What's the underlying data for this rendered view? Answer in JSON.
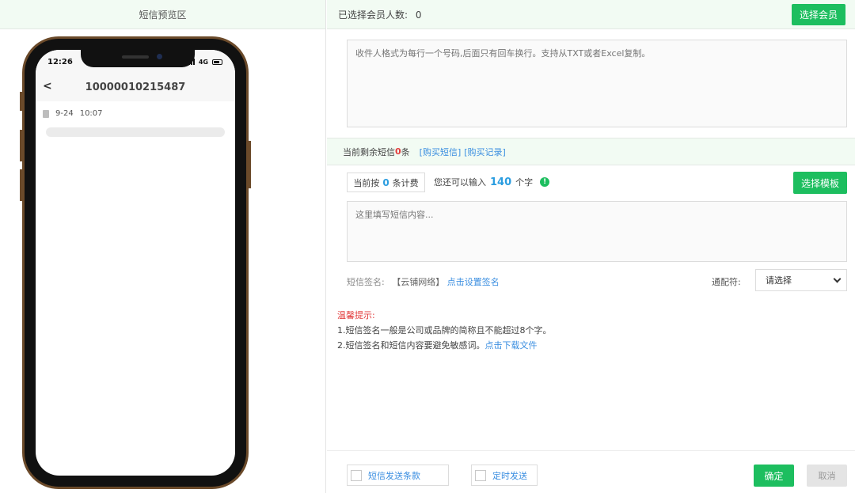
{
  "preview_panel": {
    "title": "短信预览区",
    "phone": {
      "time": "12:26",
      "network": "4G",
      "back_symbol": "<",
      "contact_number": "10000010215487",
      "message_date": "9-24",
      "message_time": "10:07"
    }
  },
  "recipients": {
    "selected_label": "已选择会员人数:",
    "selected_count": "0",
    "select_button": "选择会员",
    "placeholder": "收件人格式为每行一个号码,后面只有回车换行。支持从TXT或者Excel复制。"
  },
  "balance": {
    "prefix": "当前剩余短信",
    "count": "0",
    "suffix": "条",
    "buy_link": "[购买短信]",
    "history_link": "[购买记录]"
  },
  "composer": {
    "billing_prefix": "当前按",
    "billing_count": "0",
    "billing_suffix": "条计费",
    "remain_prefix": "您还可以输入",
    "remain_count": "140",
    "remain_suffix": "个字",
    "template_button": "选择模板",
    "content_placeholder": "这里填写短信内容..."
  },
  "signature": {
    "label": "短信签名:",
    "value": "【云铺网络】",
    "set_link": "点击设置签名"
  },
  "wildcard": {
    "label": "通配符:",
    "selected": "请选择"
  },
  "tips": {
    "title": "温馨提示:",
    "line1": "1.短信签名一般是公司或品牌的简称且不能超过8个字。",
    "line2_text": "2.短信签名和短信内容要避免敏感词。",
    "line2_link": "点击下载文件"
  },
  "footer": {
    "terms_checkbox": "短信发送条款",
    "timed_checkbox": "定时发送",
    "confirm_button": "确定",
    "cancel_button": "取消"
  },
  "colors": {
    "accent_green": "#1dbe5f",
    "link_blue": "#3a8ee0",
    "warning_red": "#e23b3b",
    "header_bg": "#f2fbf3"
  }
}
